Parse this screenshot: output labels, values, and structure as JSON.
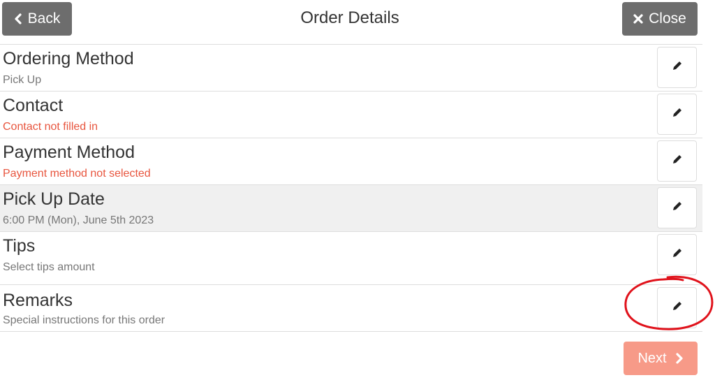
{
  "header": {
    "back_label": "Back",
    "title": "Order Details",
    "close_label": "Close"
  },
  "rows": [
    {
      "label": "Ordering Method",
      "value": "Pick Up",
      "status": "normal"
    },
    {
      "label": "Contact",
      "value": "Contact not filled in",
      "status": "warning"
    },
    {
      "label": "Payment Method",
      "value": "Payment method not selected",
      "status": "warning"
    },
    {
      "label": "Pick Up Date",
      "value": "6:00 PM (Mon), June 5th 2023",
      "status": "normal"
    },
    {
      "label": "Tips",
      "value": "Select tips amount",
      "status": "normal"
    },
    {
      "label": "Remarks",
      "value": "Special instructions for this order",
      "status": "normal"
    }
  ],
  "footer": {
    "next_label": "Next"
  },
  "colors": {
    "dark_button": "#6d6d6d",
    "warning_text": "#e8553e",
    "next_button": "#f79a88",
    "annotation_circle": "#e0121b"
  },
  "icons": {
    "back": "chevron-left-icon",
    "close": "x-icon",
    "edit": "pencil-icon",
    "next": "chevron-right-icon"
  }
}
